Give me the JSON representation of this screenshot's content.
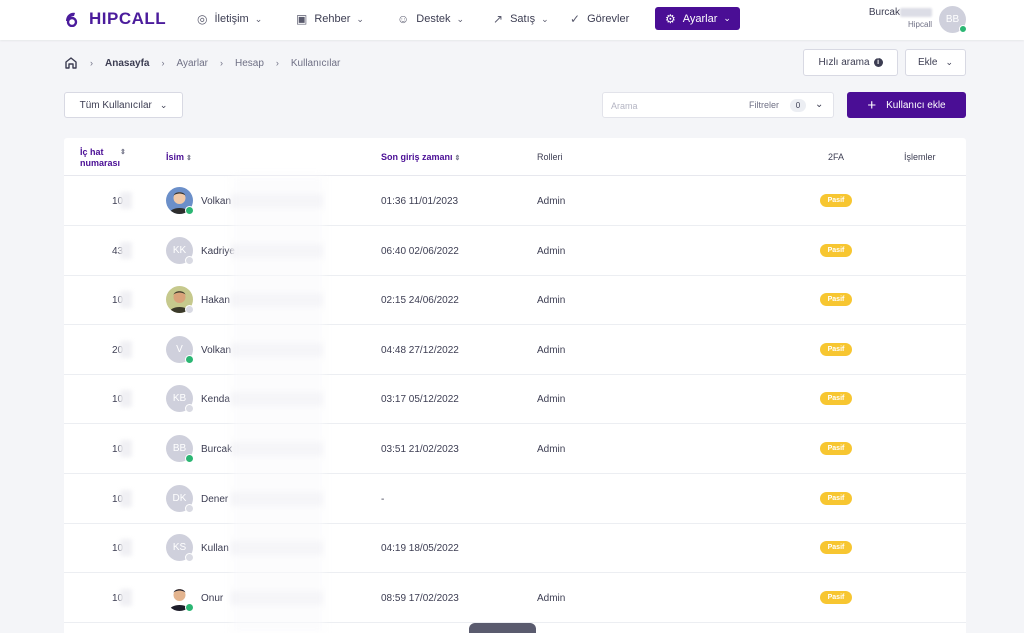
{
  "brand": {
    "name": "HIPCALL",
    "color": "#4a0e95"
  },
  "nav": {
    "items": [
      {
        "label": "İletişim",
        "icon": "chat-icon"
      },
      {
        "label": "Rehber",
        "icon": "contacts-icon"
      },
      {
        "label": "Destek",
        "icon": "smile-icon"
      },
      {
        "label": "Satış",
        "icon": "trend-icon"
      },
      {
        "label": "Görevler",
        "icon": "check-circle-icon"
      },
      {
        "label": "Ayarlar",
        "icon": "gear-icon",
        "active": true
      }
    ]
  },
  "user": {
    "name": "Burcak",
    "org": "Hipcall",
    "initials": "BB",
    "online": true
  },
  "breadcrumb": [
    "Anasayfa",
    "Ayarlar",
    "Hesap",
    "Kullanıcılar"
  ],
  "actions": {
    "quick_search": "Hızlı arama",
    "add_menu": "Ekle"
  },
  "filter": {
    "selected": "Tüm Kullanıcılar"
  },
  "search": {
    "placeholder": "Arama",
    "filters_label": "Filtreler",
    "filters_count": "0"
  },
  "add_user_label": "Kullanıcı ekle",
  "table": {
    "headers": {
      "ext_line1": "İç hat",
      "ext_line2": "numarası",
      "name": "İsim",
      "last_login": "Son giriş zamanı",
      "roles": "Rolleri",
      "twofa": "2FA",
      "actions": "İşlemler"
    },
    "rows": [
      {
        "ext": "10",
        "initials": "",
        "photo": "photo-1",
        "name": "Volkan",
        "login": "01:36 11/01/2023",
        "role": "Admin",
        "twofa": "Pasif",
        "online": true
      },
      {
        "ext": "43",
        "initials": "KK",
        "photo": "",
        "name": "Kadriye",
        "login": "06:40 02/06/2022",
        "role": "Admin",
        "twofa": "Pasif",
        "online": false
      },
      {
        "ext": "10",
        "initials": "",
        "photo": "photo-2",
        "name": "Hakan",
        "login": "02:15 24/06/2022",
        "role": "Admin",
        "twofa": "Pasif",
        "online": false
      },
      {
        "ext": "20",
        "initials": "V",
        "photo": "",
        "name": "Volkan",
        "login": "04:48 27/12/2022",
        "role": "Admin",
        "twofa": "Pasif",
        "online": true
      },
      {
        "ext": "10",
        "initials": "KB",
        "photo": "",
        "name": "Kenda",
        "login": "03:17 05/12/2022",
        "role": "Admin",
        "twofa": "Pasif",
        "online": false
      },
      {
        "ext": "10",
        "initials": "BB",
        "photo": "",
        "name": "Burcak",
        "login": "03:51 21/02/2023",
        "role": "Admin",
        "twofa": "Pasif",
        "online": true
      },
      {
        "ext": "10",
        "initials": "DK",
        "photo": "",
        "name": "Dener",
        "login": "-",
        "role": "",
        "twofa": "Pasif",
        "online": false
      },
      {
        "ext": "10",
        "initials": "KS",
        "photo": "",
        "name": "Kullan",
        "login": "04:19 18/05/2022",
        "role": "",
        "twofa": "Pasif",
        "online": false
      },
      {
        "ext": "10",
        "initials": "",
        "photo": "photo-3",
        "name": "Onur",
        "login": "08:59 17/02/2023",
        "role": "Admin",
        "twofa": "Pasif",
        "online": true
      }
    ]
  }
}
